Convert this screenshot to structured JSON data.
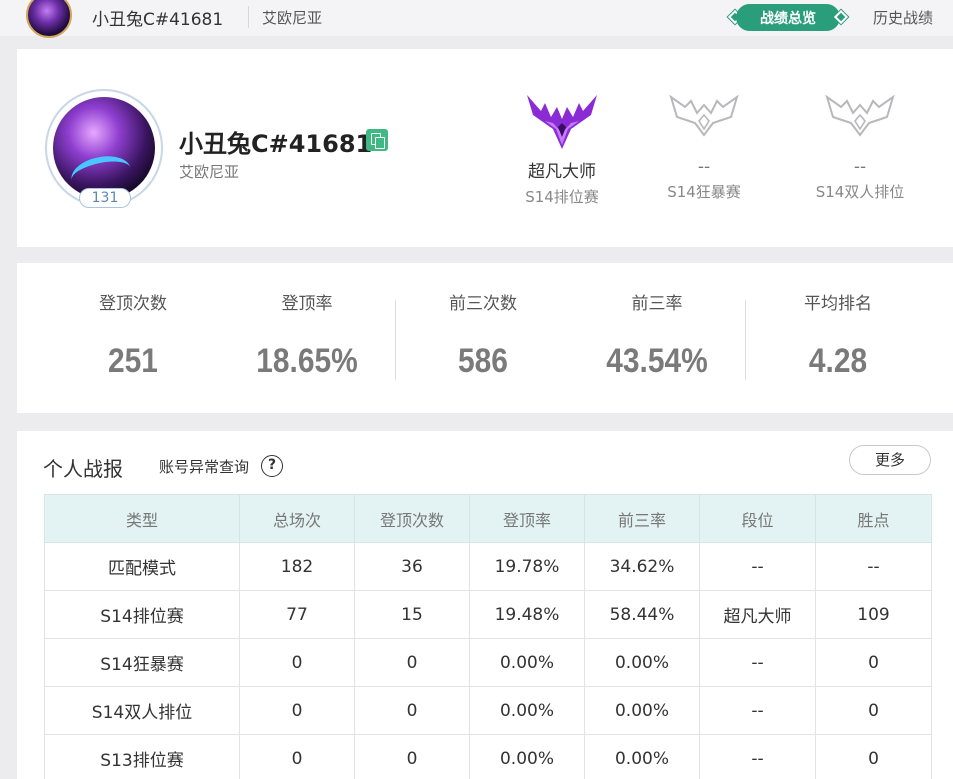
{
  "topbar": {
    "name": "小丑兔C#41681",
    "region": "艾欧尼亚",
    "tab_active": "战绩总览",
    "tab_history": "历史战绩"
  },
  "profile": {
    "name": "小丑兔C#41681",
    "region": "艾欧尼亚",
    "level": "131",
    "ranks": [
      {
        "tier": "超凡大师",
        "mode": "S14排位赛",
        "icon": "master-wings-icon"
      },
      {
        "tier": "--",
        "mode": "S14狂暴赛",
        "icon": "unranked-wings-icon"
      },
      {
        "tier": "--",
        "mode": "S14双人排位",
        "icon": "unranked-wings-icon"
      }
    ]
  },
  "stats": [
    {
      "label": "登顶次数",
      "value": "251"
    },
    {
      "label": "登顶率",
      "value": "18.65%"
    },
    {
      "label": "前三次数",
      "value": "586"
    },
    {
      "label": "前三率",
      "value": "43.54%"
    },
    {
      "label": "平均排名",
      "value": "4.28"
    }
  ],
  "report": {
    "title": "个人战报",
    "query_label": "账号异常查询",
    "help_glyph": "?",
    "more_label": "更多",
    "columns": [
      "类型",
      "总场次",
      "登顶次数",
      "登顶率",
      "前三率",
      "段位",
      "胜点"
    ],
    "rows": [
      [
        "匹配模式",
        "182",
        "36",
        "19.78%",
        "34.62%",
        "--",
        "--"
      ],
      [
        "S14排位赛",
        "77",
        "15",
        "19.48%",
        "58.44%",
        "超凡大师",
        "109"
      ],
      [
        "S14狂暴赛",
        "0",
        "0",
        "0.00%",
        "0.00%",
        "--",
        "0"
      ],
      [
        "S14双人排位",
        "0",
        "0",
        "0.00%",
        "0.00%",
        "--",
        "0"
      ],
      [
        "S13排位赛",
        "0",
        "0",
        "0.00%",
        "0.00%",
        "--",
        "0"
      ]
    ]
  },
  "colors": {
    "accent": "#2a9d7a",
    "copy_icon": "#3fb883",
    "table_header_bg": "#e3f2f2",
    "master_purple": "#8a2bd6"
  }
}
